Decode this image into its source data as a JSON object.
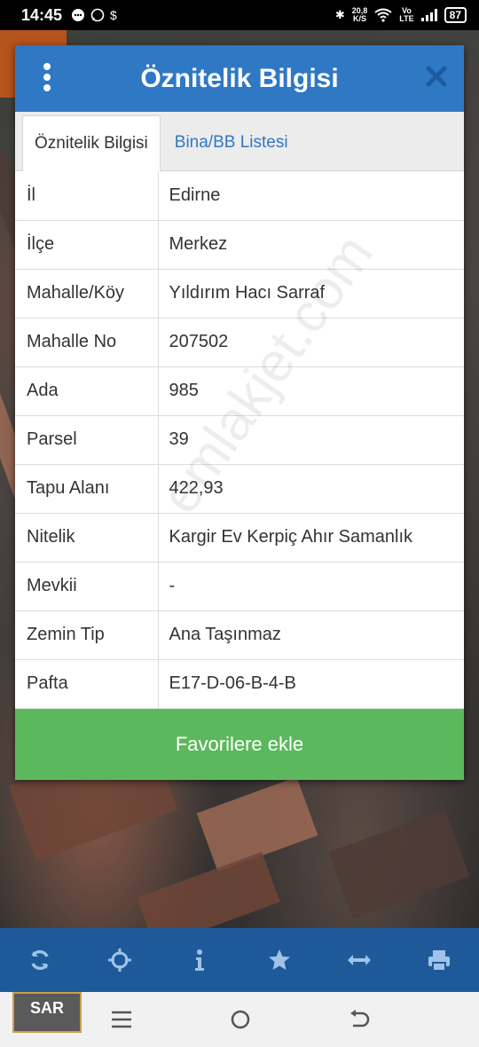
{
  "status_bar": {
    "time": "14:45",
    "net_speed_value": "20,8",
    "net_speed_unit": "K/S",
    "network_top": "Vo",
    "network_bottom": "LTE",
    "battery": "87"
  },
  "dialog": {
    "title": "Öznitelik Bilgisi",
    "tabs": [
      {
        "label": "Öznitelik Bilgisi",
        "active": true
      },
      {
        "label": "Bina/BB Listesi",
        "active": false
      }
    ],
    "rows": [
      {
        "key": "İl",
        "value": "Edirne"
      },
      {
        "key": "İlçe",
        "value": "Merkez"
      },
      {
        "key": "Mahalle/Köy",
        "value": "Yıldırım Hacı Sarraf"
      },
      {
        "key": "Mahalle No",
        "value": "207502"
      },
      {
        "key": "Ada",
        "value": "985"
      },
      {
        "key": "Parsel",
        "value": "39"
      },
      {
        "key": "Tapu Alanı",
        "value": "422,93"
      },
      {
        "key": "Nitelik",
        "value": "Kargir Ev Kerpiç Ahır Samanlık"
      },
      {
        "key": "Mevkii",
        "value": "-"
      },
      {
        "key": "Zemin Tip",
        "value": "Ana Taşınmaz"
      },
      {
        "key": "Pafta",
        "value": "E17-D-06-B-4-B"
      }
    ],
    "favorite_button": "Favorilere ekle"
  },
  "watermark": "emlakjet.com",
  "logo_text": "SAR",
  "toolbar_icons": [
    "refresh-icon",
    "locate-icon",
    "info-icon",
    "star-icon",
    "measure-icon",
    "print-icon"
  ],
  "colors": {
    "header_blue": "#2f78c4",
    "toolbar_blue": "#1e5a9a",
    "button_green": "#5cb85c"
  }
}
